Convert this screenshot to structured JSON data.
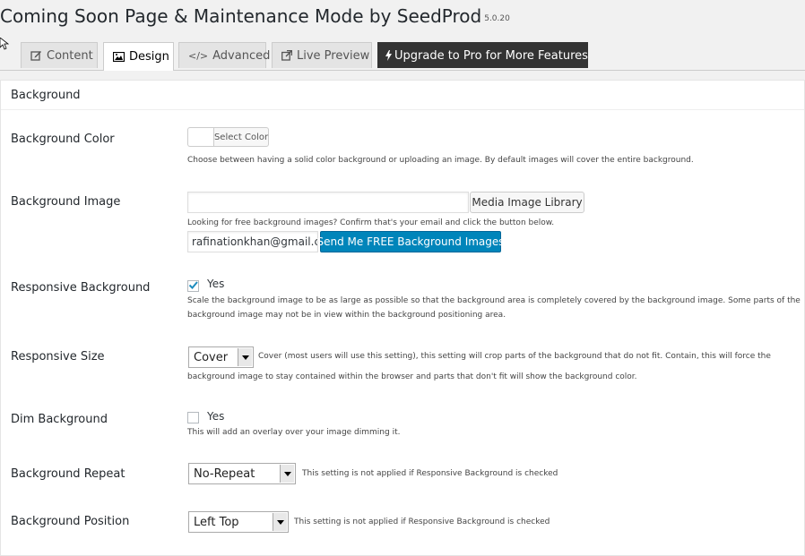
{
  "page": {
    "title": "Coming Soon Page & Maintenance Mode by SeedProd",
    "version": "5.0.20"
  },
  "tabs": [
    {
      "label": "Content",
      "icon": "edit-icon"
    },
    {
      "label": "Design",
      "icon": "image-icon"
    },
    {
      "label": "Advanced",
      "icon": "code-icon"
    },
    {
      "label": "Live Preview",
      "icon": "external-link-icon"
    },
    {
      "label": "Upgrade to Pro for More Features",
      "icon": "bolt-icon"
    }
  ],
  "section": {
    "title": "Background"
  },
  "fields": {
    "bg_color": {
      "label": "Background Color",
      "button": "Select Color",
      "desc": "Choose between having a solid color background or uploading an image. By default images will cover the entire background."
    },
    "bg_image": {
      "label": "Background Image",
      "value": "",
      "button": "Media Image Library",
      "desc": "Looking for free background images? Confirm that's your email and click the button below.",
      "email": "rafinationkhan@gmail.c",
      "send_button": "Send Me FREE Background Images"
    },
    "responsive_bg": {
      "label": "Responsive Background",
      "checked": true,
      "option": "Yes",
      "desc1": "Scale the background image to be as large as possible so that the background area is completely covered by the background image. Some parts of the",
      "desc2": "background image may not be in view within the background positioning area."
    },
    "responsive_size": {
      "label": "Responsive Size",
      "selected": "Cover",
      "desc1": "Cover (most users will use this setting), this setting will crop parts of the background that do not fit. Contain, this will force the",
      "desc2": "background image to stay contained within the browser and parts that don't fit will show the background color."
    },
    "dim_bg": {
      "label": "Dim Background",
      "checked": false,
      "option": "Yes",
      "desc": "This will add an overlay over your image dimming it."
    },
    "bg_repeat": {
      "label": "Background Repeat",
      "selected": "No-Repeat",
      "desc": "This setting is not applied if Responsive Background is checked"
    },
    "bg_position": {
      "label": "Background Position",
      "selected": "Left Top",
      "desc": "This setting is not applied if Responsive Background is checked"
    }
  },
  "colors": {
    "primary": "#0085ba",
    "pro_tab": "#333333",
    "check": "#1e8cbe"
  }
}
